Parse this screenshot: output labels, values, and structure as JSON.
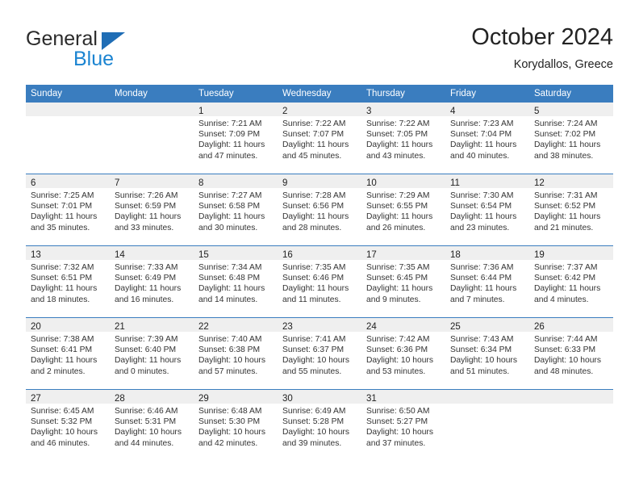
{
  "brand": {
    "name_top": "General",
    "name_bottom": "Blue",
    "triangle_icon": "brand-triangle-icon",
    "accent_color": "#1b84d1",
    "dark_color": "#2b2b2b"
  },
  "header": {
    "title": "October 2024",
    "subtitle": "Korydallos, Greece"
  },
  "theme": {
    "header_row_bg": "#3a7dbf",
    "header_row_text": "#ffffff",
    "daynum_band_bg": "#efefef",
    "row_divider": "#3a7dbf",
    "body_text": "#333333"
  },
  "weekday_headers": [
    "Sunday",
    "Monday",
    "Tuesday",
    "Wednesday",
    "Thursday",
    "Friday",
    "Saturday"
  ],
  "weeks": [
    [
      {
        "day": "",
        "lines": []
      },
      {
        "day": "",
        "lines": []
      },
      {
        "day": "1",
        "lines": [
          "Sunrise: 7:21 AM",
          "Sunset: 7:09 PM",
          "Daylight: 11 hours and 47 minutes."
        ]
      },
      {
        "day": "2",
        "lines": [
          "Sunrise: 7:22 AM",
          "Sunset: 7:07 PM",
          "Daylight: 11 hours and 45 minutes."
        ]
      },
      {
        "day": "3",
        "lines": [
          "Sunrise: 7:22 AM",
          "Sunset: 7:05 PM",
          "Daylight: 11 hours and 43 minutes."
        ]
      },
      {
        "day": "4",
        "lines": [
          "Sunrise: 7:23 AM",
          "Sunset: 7:04 PM",
          "Daylight: 11 hours and 40 minutes."
        ]
      },
      {
        "day": "5",
        "lines": [
          "Sunrise: 7:24 AM",
          "Sunset: 7:02 PM",
          "Daylight: 11 hours and 38 minutes."
        ]
      }
    ],
    [
      {
        "day": "6",
        "lines": [
          "Sunrise: 7:25 AM",
          "Sunset: 7:01 PM",
          "Daylight: 11 hours and 35 minutes."
        ]
      },
      {
        "day": "7",
        "lines": [
          "Sunrise: 7:26 AM",
          "Sunset: 6:59 PM",
          "Daylight: 11 hours and 33 minutes."
        ]
      },
      {
        "day": "8",
        "lines": [
          "Sunrise: 7:27 AM",
          "Sunset: 6:58 PM",
          "Daylight: 11 hours and 30 minutes."
        ]
      },
      {
        "day": "9",
        "lines": [
          "Sunrise: 7:28 AM",
          "Sunset: 6:56 PM",
          "Daylight: 11 hours and 28 minutes."
        ]
      },
      {
        "day": "10",
        "lines": [
          "Sunrise: 7:29 AM",
          "Sunset: 6:55 PM",
          "Daylight: 11 hours and 26 minutes."
        ]
      },
      {
        "day": "11",
        "lines": [
          "Sunrise: 7:30 AM",
          "Sunset: 6:54 PM",
          "Daylight: 11 hours and 23 minutes."
        ]
      },
      {
        "day": "12",
        "lines": [
          "Sunrise: 7:31 AM",
          "Sunset: 6:52 PM",
          "Daylight: 11 hours and 21 minutes."
        ]
      }
    ],
    [
      {
        "day": "13",
        "lines": [
          "Sunrise: 7:32 AM",
          "Sunset: 6:51 PM",
          "Daylight: 11 hours and 18 minutes."
        ]
      },
      {
        "day": "14",
        "lines": [
          "Sunrise: 7:33 AM",
          "Sunset: 6:49 PM",
          "Daylight: 11 hours and 16 minutes."
        ]
      },
      {
        "day": "15",
        "lines": [
          "Sunrise: 7:34 AM",
          "Sunset: 6:48 PM",
          "Daylight: 11 hours and 14 minutes."
        ]
      },
      {
        "day": "16",
        "lines": [
          "Sunrise: 7:35 AM",
          "Sunset: 6:46 PM",
          "Daylight: 11 hours and 11 minutes."
        ]
      },
      {
        "day": "17",
        "lines": [
          "Sunrise: 7:35 AM",
          "Sunset: 6:45 PM",
          "Daylight: 11 hours and 9 minutes."
        ]
      },
      {
        "day": "18",
        "lines": [
          "Sunrise: 7:36 AM",
          "Sunset: 6:44 PM",
          "Daylight: 11 hours and 7 minutes."
        ]
      },
      {
        "day": "19",
        "lines": [
          "Sunrise: 7:37 AM",
          "Sunset: 6:42 PM",
          "Daylight: 11 hours and 4 minutes."
        ]
      }
    ],
    [
      {
        "day": "20",
        "lines": [
          "Sunrise: 7:38 AM",
          "Sunset: 6:41 PM",
          "Daylight: 11 hours and 2 minutes."
        ]
      },
      {
        "day": "21",
        "lines": [
          "Sunrise: 7:39 AM",
          "Sunset: 6:40 PM",
          "Daylight: 11 hours and 0 minutes."
        ]
      },
      {
        "day": "22",
        "lines": [
          "Sunrise: 7:40 AM",
          "Sunset: 6:38 PM",
          "Daylight: 10 hours and 57 minutes."
        ]
      },
      {
        "day": "23",
        "lines": [
          "Sunrise: 7:41 AM",
          "Sunset: 6:37 PM",
          "Daylight: 10 hours and 55 minutes."
        ]
      },
      {
        "day": "24",
        "lines": [
          "Sunrise: 7:42 AM",
          "Sunset: 6:36 PM",
          "Daylight: 10 hours and 53 minutes."
        ]
      },
      {
        "day": "25",
        "lines": [
          "Sunrise: 7:43 AM",
          "Sunset: 6:34 PM",
          "Daylight: 10 hours and 51 minutes."
        ]
      },
      {
        "day": "26",
        "lines": [
          "Sunrise: 7:44 AM",
          "Sunset: 6:33 PM",
          "Daylight: 10 hours and 48 minutes."
        ]
      }
    ],
    [
      {
        "day": "27",
        "lines": [
          "Sunrise: 6:45 AM",
          "Sunset: 5:32 PM",
          "Daylight: 10 hours and 46 minutes."
        ]
      },
      {
        "day": "28",
        "lines": [
          "Sunrise: 6:46 AM",
          "Sunset: 5:31 PM",
          "Daylight: 10 hours and 44 minutes."
        ]
      },
      {
        "day": "29",
        "lines": [
          "Sunrise: 6:48 AM",
          "Sunset: 5:30 PM",
          "Daylight: 10 hours and 42 minutes."
        ]
      },
      {
        "day": "30",
        "lines": [
          "Sunrise: 6:49 AM",
          "Sunset: 5:28 PM",
          "Daylight: 10 hours and 39 minutes."
        ]
      },
      {
        "day": "31",
        "lines": [
          "Sunrise: 6:50 AM",
          "Sunset: 5:27 PM",
          "Daylight: 10 hours and 37 minutes."
        ]
      },
      {
        "day": "",
        "lines": []
      },
      {
        "day": "",
        "lines": []
      }
    ]
  ]
}
